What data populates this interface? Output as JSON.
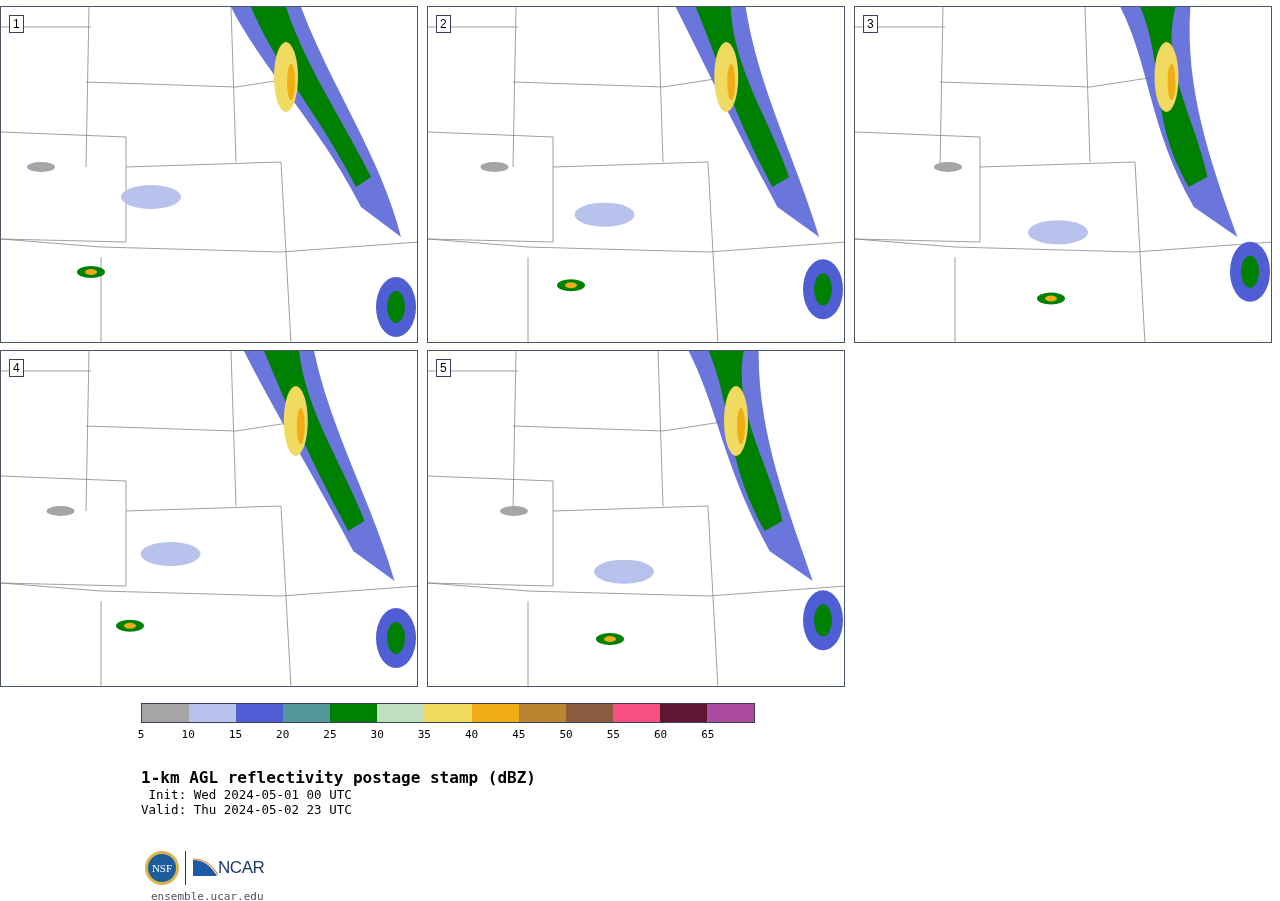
{
  "panels": [
    {
      "label": "1"
    },
    {
      "label": "2"
    },
    {
      "label": "3"
    },
    {
      "label": "4"
    },
    {
      "label": "5"
    }
  ],
  "colorbar": {
    "bins": [
      {
        "label": "5",
        "color": "#a5a5a5"
      },
      {
        "label": "10",
        "color": "#b8c3ed"
      },
      {
        "label": "15",
        "color": "#505ed6"
      },
      {
        "label": "20",
        "color": "#51979b"
      },
      {
        "label": "25",
        "color": "#008000"
      },
      {
        "label": "30",
        "color": "#bfdfbf"
      },
      {
        "label": "35",
        "color": "#f0da5f"
      },
      {
        "label": "40",
        "color": "#f0ad15"
      },
      {
        "label": "45",
        "color": "#bb8530"
      },
      {
        "label": "50",
        "color": "#8a5b3f"
      },
      {
        "label": "55",
        "color": "#f64f81"
      },
      {
        "label": "60",
        "color": "#5f1734"
      },
      {
        "label": "65",
        "color": "#ad4aa1"
      }
    ]
  },
  "title": "1-km AGL reflectivity postage stamp (dBZ)",
  "init": " Init: Wed 2024-05-01 00 UTC",
  "valid": "Valid: Thu 2024-05-02 23 UTC",
  "logos": {
    "nsf": "NSF",
    "ncar": "NCAR"
  },
  "url": "ensemble.ucar.edu"
}
